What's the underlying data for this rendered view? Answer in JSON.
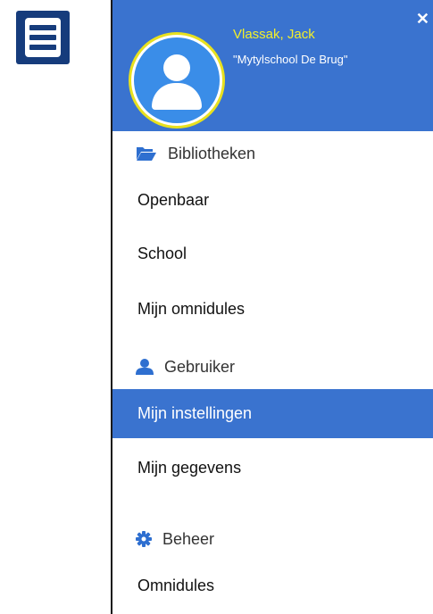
{
  "user": {
    "name": "Vlassak, Jack",
    "school": "\"Mytylschool De Brug\""
  },
  "icons": {
    "menu": "hamburger-menu-icon",
    "close": "close-icon",
    "avatar": "user-avatar-icon",
    "libraries": "folder-open-icon",
    "user": "user-icon",
    "admin": "gear-icon"
  },
  "colors": {
    "accent": "#3a73cf",
    "menu_toggle": "#163c7c",
    "user_name": "#f2ef2a",
    "avatar_ring": "#e8e11e",
    "icon_blue": "#2e6fd0"
  },
  "menu": {
    "sections": [
      {
        "header": "Bibliotheken",
        "items": [
          "Openbaar",
          "School",
          "Mijn omnidules"
        ]
      },
      {
        "header": "Gebruiker",
        "items": [
          "Mijn instellingen",
          "Mijn gegevens"
        ]
      },
      {
        "header": "Beheer",
        "items": [
          "Omnidules"
        ]
      }
    ],
    "active_item": "Mijn instellingen"
  }
}
